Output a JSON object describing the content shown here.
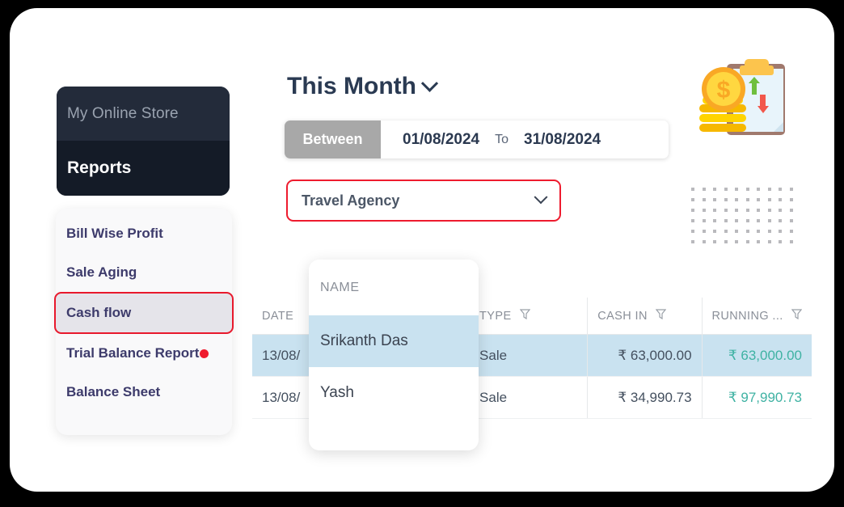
{
  "app": {
    "store_name": "My Online Store",
    "section": "Reports"
  },
  "sidebar": {
    "items": [
      {
        "label": "Bill Wise Profit",
        "active": false,
        "badge": false
      },
      {
        "label": "Sale Aging",
        "active": false,
        "badge": false
      },
      {
        "label": "Cash flow",
        "active": true,
        "badge": false
      },
      {
        "label": "Trial Balance Report",
        "active": false,
        "badge": true
      },
      {
        "label": "Balance Sheet",
        "active": false,
        "badge": false
      }
    ]
  },
  "header": {
    "period_label": "This Month",
    "chevron_icon": "chevron-down-icon"
  },
  "daterange": {
    "mode_label": "Between",
    "from_date": "01/08/2024",
    "to_label": "To",
    "to_date": "31/08/2024"
  },
  "filter_select": {
    "value": "Travel Agency",
    "chevron_icon": "chevron-down-icon"
  },
  "illustration": {
    "name": "cash-flow-report-illustration"
  },
  "table": {
    "columns": [
      {
        "label": "DATE",
        "filter": false
      },
      {
        "label": "NAME",
        "filter": false
      },
      {
        "label": "TYPE",
        "filter": true
      },
      {
        "label": "CASH IN",
        "filter": true
      },
      {
        "label": "RUNNING ...",
        "filter": true
      }
    ],
    "rows": [
      {
        "date": "13/08/",
        "name": "Srikanth Das",
        "type": "Sale",
        "cash_in": "₹ 63,000.00",
        "running": "₹ 63,000.00",
        "highlighted": true
      },
      {
        "date": "13/08/",
        "name": "Yash",
        "type": "Sale",
        "cash_in": "₹ 34,990.73",
        "running": "₹ 97,990.73",
        "highlighted": false
      }
    ]
  },
  "name_popover": {
    "header": "NAME",
    "items": [
      {
        "label": "Srikanth Das",
        "highlighted": true
      },
      {
        "label": "Yash",
        "highlighted": false
      }
    ]
  },
  "colors": {
    "accent_red": "#ee1b2e",
    "dark_panel_top": "#232b3a",
    "dark_panel_bottom": "#141b27",
    "menu_text": "#3d3b6b",
    "row_highlight": "#c9e2f0",
    "running_value": "#3fb2a3",
    "between_button": "#a8a8a8"
  }
}
